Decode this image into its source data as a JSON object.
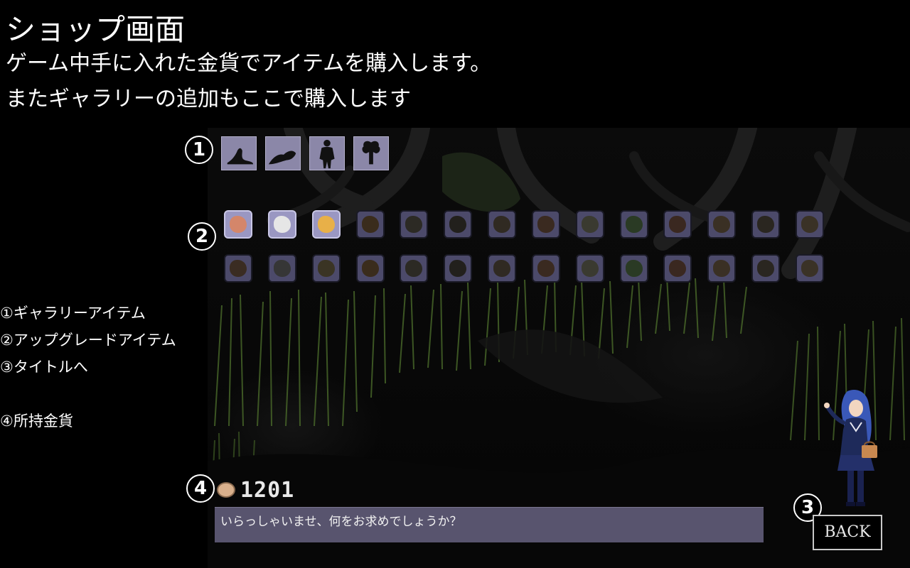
{
  "header": {
    "title": "ショップ画面",
    "description_1": "ゲーム中手に入れた金貨でアイテムを購入します。",
    "description_2": "またギャラリーの追加もここで購入します"
  },
  "legend": [
    "①ギャラリーアイテム",
    "②アップグレードアイテム",
    "③タイトルへ",
    "④所持金貨"
  ],
  "markers": {
    "gallery": "1",
    "upgrade": "2",
    "back": "3",
    "coins": "4"
  },
  "gallery_items": [
    {
      "icon": "silhouette-lying-figure-icon"
    },
    {
      "icon": "silhouette-crawling-figure-icon"
    },
    {
      "icon": "silhouette-standing-figure-icon"
    },
    {
      "icon": "silhouette-winged-figure-icon"
    }
  ],
  "upgrade_items": {
    "row1": [
      {
        "icon": "meat-icon",
        "state": "active",
        "color": "#d4866a"
      },
      {
        "icon": "bone-icon",
        "state": "active",
        "color": "#e6e6e6"
      },
      {
        "icon": "spark-icon",
        "state": "active",
        "color": "#e8b048"
      },
      {
        "icon": "seed-icon",
        "state": "dim",
        "color": "#3a2c1c"
      },
      {
        "icon": "stone-icon",
        "state": "dim",
        "color": "#2c2a24"
      },
      {
        "icon": "egg-icon",
        "state": "dim",
        "color": "#22201c"
      },
      {
        "icon": "claw-icon",
        "state": "dim",
        "color": "#302a22"
      },
      {
        "icon": "bottle-icon",
        "state": "dim",
        "color": "#3a2a20"
      },
      {
        "icon": "rock-icon",
        "state": "dim",
        "color": "#3a3a30"
      },
      {
        "icon": "leaf-icon",
        "state": "dim",
        "color": "#2a3a24"
      },
      {
        "icon": "pot-icon",
        "state": "dim",
        "color": "#3a2820"
      },
      {
        "icon": "sack-icon",
        "state": "dim",
        "color": "#3a3024"
      },
      {
        "icon": "boot-icon",
        "state": "dim",
        "color": "#2a2620"
      },
      {
        "icon": "wing-icon",
        "state": "dim",
        "color": "#3a3226"
      }
    ],
    "row2": [
      {
        "icon": "meat-lv-icon",
        "state": "dim",
        "color": "#3a2c22"
      },
      {
        "icon": "bone-lv-icon",
        "state": "dim",
        "color": "#363636"
      },
      {
        "icon": "spark-lv-icon",
        "state": "dim",
        "color": "#3a3424"
      },
      {
        "icon": "seed-lv-icon",
        "state": "dim",
        "color": "#3a2c1c"
      },
      {
        "icon": "stone-lv-icon",
        "state": "dim",
        "color": "#2c2a24"
      },
      {
        "icon": "egg-lv-icon",
        "state": "dim",
        "color": "#22201c"
      },
      {
        "icon": "claw-lv-icon",
        "state": "dim",
        "color": "#302a22"
      },
      {
        "icon": "bottle-lv-icon",
        "state": "dim",
        "color": "#3a2a20"
      },
      {
        "icon": "rock-lv-icon",
        "state": "dim",
        "color": "#3a3a30"
      },
      {
        "icon": "leaf-lv-icon",
        "state": "dim",
        "color": "#2a3a24"
      },
      {
        "icon": "pot-lv-icon",
        "state": "dim",
        "color": "#3a2820"
      },
      {
        "icon": "sack-lv-icon",
        "state": "dim",
        "color": "#3a3024"
      },
      {
        "icon": "boot-lv-icon",
        "state": "dim",
        "color": "#2a2620"
      },
      {
        "icon": "wing-lv-icon",
        "state": "dim",
        "color": "#3a3226"
      }
    ]
  },
  "coins": {
    "icon": "coin-icon",
    "amount": "1201"
  },
  "message": {
    "text": "いらっしゃいませ、何をお求めでしょうか？"
  },
  "back_button": {
    "label": "BACK"
  },
  "colors": {
    "panel": "#58546e",
    "item_active": "#9a97c2",
    "item_dim": "#4c4a6a",
    "grass": "#4a6a2a"
  }
}
